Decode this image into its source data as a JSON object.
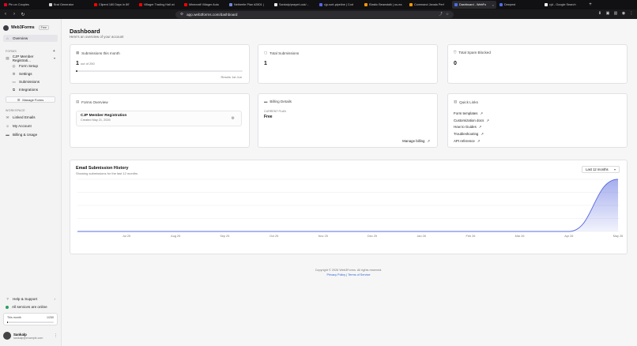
{
  "browser": {
    "tabs": [
      {
        "label": "Pin on Couples",
        "color": "#e60023"
      },
      {
        "label": "Brat Generator",
        "color": "#d8d8d8"
      },
      {
        "label": "Clipent 180 Days in 80'",
        "color": "#ff0000"
      },
      {
        "label": "Villager Trading Hall wi",
        "color": "#ff0000"
      },
      {
        "label": "Minecraft Villager Auto",
        "color": "#ff0000"
      },
      {
        "label": "Netherite Plan #2801 |",
        "color": "#7289da"
      },
      {
        "label": "Sankalp/prayerLock/...",
        "color": "#eeeeee"
      },
      {
        "label": "cjp-sort-pipeline | Cod",
        "color": "#5865f2"
      },
      {
        "label": "Elastic Beanstalk | us-ea",
        "color": "#ff9900"
      },
      {
        "label": "Command Janala Perf",
        "color": "#ff9900"
      },
      {
        "label": "Dashboard - WebFo",
        "color": "#4f6bed",
        "active": true
      },
      {
        "label": "Deepest",
        "color": "#4f6bed"
      },
      {
        "label": "cjd - Google Search",
        "color": "#ffffff"
      }
    ],
    "url": "app.web3forms.com/dashboard"
  },
  "sidebar": {
    "brand": "Web3Forms",
    "plan_badge": "Free",
    "overview": "Overview",
    "forms_label": "FORMS",
    "form_name": "CJP Member Registrati...",
    "form_subitems": [
      "Form Setup",
      "Settings",
      "Submissions",
      "Integrations"
    ],
    "manage_forms": "Manage Forms",
    "workspace_label": "WORKSPACE",
    "workspace_items": [
      "Linked Emails",
      "My Account",
      "Billing & Usage"
    ],
    "help": "Help & Support",
    "status": "All services are online",
    "usage": {
      "label": "This month",
      "count": "1/250",
      "fraction": 0.004
    },
    "user": {
      "name": "Sankalp",
      "email": "sankalp@example.com"
    }
  },
  "header": {
    "title": "Dashboard",
    "subtitle": "Here's an overview of your account"
  },
  "stats": {
    "submissions_month": {
      "label": "Submissions this month",
      "value": "1",
      "of": "out of 250",
      "resets": "Resets 1st Jun",
      "fraction": 0.004
    },
    "total_submissions": {
      "label": "Total Submissions",
      "value": "1"
    },
    "spam_blocked": {
      "label": "Total Spam Blocked",
      "value": "0"
    }
  },
  "forms_overview": {
    "title": "Forms Overview",
    "form_name": "CJP Member Registration",
    "created": "Created May 21, 2026"
  },
  "billing": {
    "title": "Billing Details",
    "plan_label": "CURRENT PLAN",
    "plan_value": "Free",
    "manage": "Manage billing"
  },
  "quick_links": {
    "title": "Quick Links",
    "items": [
      "Form templates",
      "Customization docs",
      "How to Guides",
      "Troubleshooting",
      "API reference"
    ]
  },
  "history": {
    "title": "Email Submission History",
    "subtitle": "Showing submissions for the last 12 months",
    "range": "Last 12 months"
  },
  "chart_data": {
    "type": "area",
    "categories": [
      "Jul 25",
      "Aug 25",
      "Sep 25",
      "Oct 25",
      "Nov 25",
      "Dec 25",
      "Jan 26",
      "Feb 26",
      "Mar 26",
      "Apr 26",
      "May 26"
    ],
    "values": [
      0,
      0,
      0,
      0,
      0,
      0,
      0,
      0,
      0,
      0,
      1
    ],
    "ylim": [
      0,
      1
    ],
    "grid": true,
    "color": "#5b6be0"
  },
  "footer": {
    "copyright": "Copyright © 2026 Web3Forms. All rights reserved.",
    "links": "Privacy Policy | Terms of Service"
  }
}
